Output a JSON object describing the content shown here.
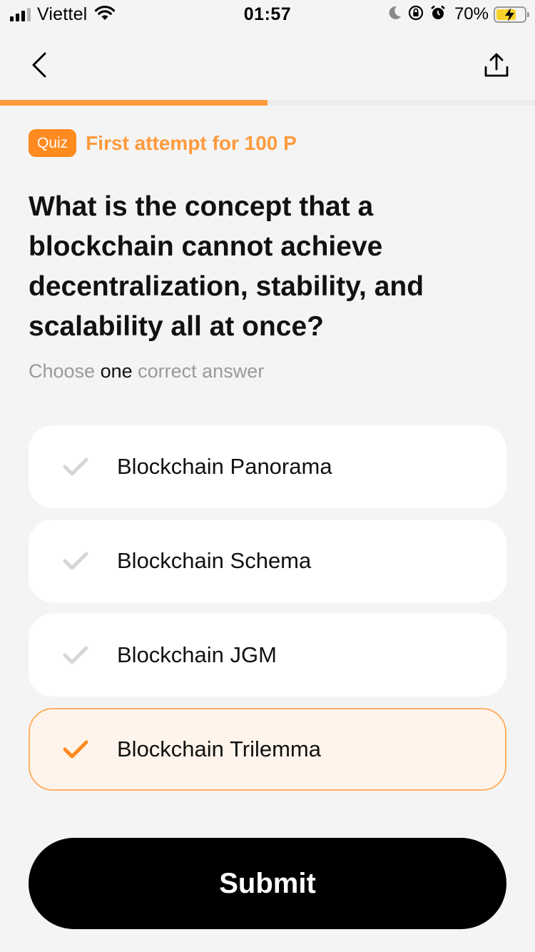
{
  "status_bar": {
    "carrier": "Viettel",
    "time": "01:57",
    "battery_percent": "70%",
    "battery_level": 0.7,
    "icons": [
      "signal-icon",
      "wifi-icon",
      "moon-icon",
      "rotation-lock-icon",
      "alarm-icon",
      "battery-charging-icon"
    ]
  },
  "nav": {
    "icons": [
      "chevron-left-icon",
      "share-icon"
    ]
  },
  "progress": {
    "fraction": 0.5,
    "color": "#ff9a3d"
  },
  "quiz": {
    "badge": "Quiz",
    "attempt_text": "First attempt for 100 P",
    "question": "What is the concept that a blockchain cannot achieve decentralization, stability, and scalability all at once?",
    "instruction_before": "Choose ",
    "instruction_emphasis": "one",
    "instruction_after": " correct answer",
    "options": [
      {
        "label": "Blockchain Panorama",
        "selected": false
      },
      {
        "label": "Blockchain Schema",
        "selected": false
      },
      {
        "label": "Blockchain JGM",
        "selected": false
      },
      {
        "label": "Blockchain Trilemma",
        "selected": true
      }
    ]
  },
  "submit_label": "Submit",
  "colors": {
    "accent": "#ff8a1f",
    "accent_light": "#ff9a3d",
    "selected_bg": "#fff4eb",
    "selected_border": "#ffb066",
    "check_unselected": "#d6d6d6"
  }
}
